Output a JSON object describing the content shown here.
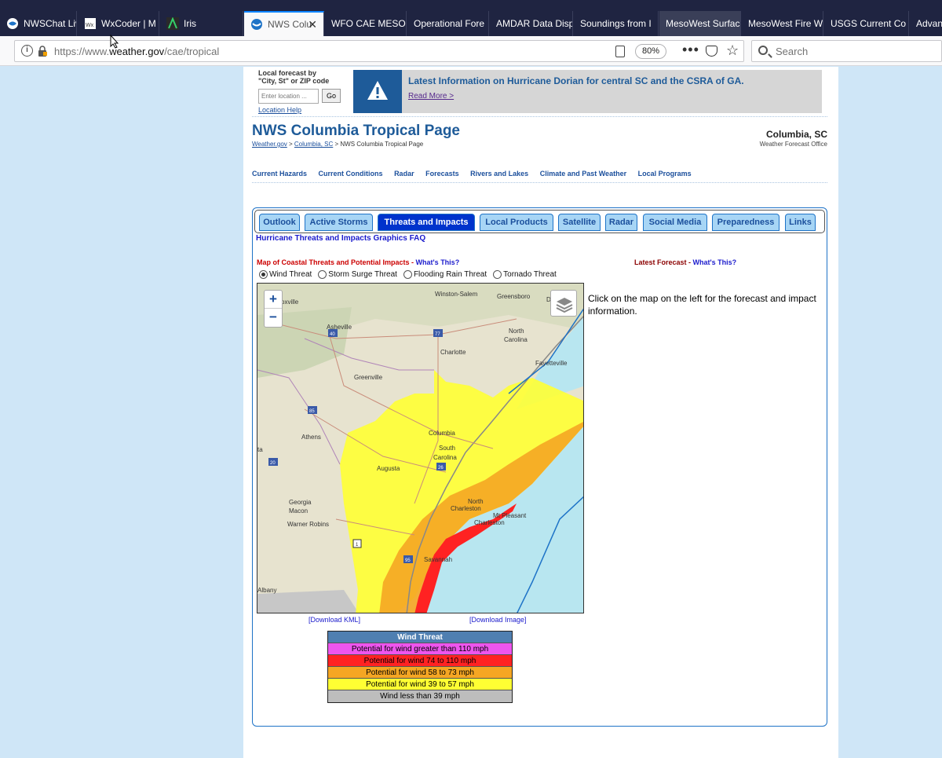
{
  "browser": {
    "tabs": [
      {
        "label": "NWSChat Liv"
      },
      {
        "label": "WxCoder | M"
      },
      {
        "label": "Iris"
      },
      {
        "label": "NWS Colu",
        "active": true
      },
      {
        "label": "WFO CAE MESOS"
      },
      {
        "label": "Operational Fore"
      },
      {
        "label": "AMDAR Data Disp"
      },
      {
        "label": "Soundings from I"
      },
      {
        "label": "MesoWest Surfac"
      },
      {
        "label": "MesoWest Fire W"
      },
      {
        "label": "USGS Current Co"
      },
      {
        "label": "Advan"
      }
    ],
    "url_prefix": "https://www.",
    "url_domain": "weather.gov",
    "url_path": "/cae/tropical",
    "zoom": "80%",
    "search_placeholder": "Search"
  },
  "location_box": {
    "label_line1": "Local forecast by",
    "label_line2": "\"City, St\" or ZIP code",
    "input_placeholder": "Enter location ...",
    "go_label": "Go",
    "help_link": "Location Help"
  },
  "alert": {
    "title": "Latest Information on Hurricane Dorian for central SC and the CSRA of GA.",
    "link": "Read More >"
  },
  "header": {
    "title": "NWS Columbia Tropical Page",
    "crumb1": "Weather.gov",
    "sep1": " > ",
    "crumb2": "Columbia, SC",
    "sep2": " > ",
    "crumb3": "NWS Columbia Tropical Page",
    "office": "Columbia, SC",
    "office_sub": "Weather Forecast Office"
  },
  "main_nav": [
    "Current Hazards",
    "Current Conditions",
    "Radar",
    "Forecasts",
    "Rivers and Lakes",
    "Climate and Past Weather",
    "Local Programs"
  ],
  "page_tabs": [
    "Outlook",
    "Active Storms",
    "Threats and Impacts",
    "Local Products",
    "Satellite",
    "Radar",
    "Social Media",
    "Preparedness",
    "Links"
  ],
  "selected_tab": "Threats and Impacts",
  "content": {
    "faq_link": "Hurricane Threats and Impacts Graphics FAQ",
    "map_title": "Map of Coastal Threats and Potential Impacts - ",
    "map_whats_this": "What's This?",
    "forecast_title": "Latest Forecast - ",
    "forecast_whats_this": "What's This?",
    "radios": [
      {
        "label": "Wind Threat",
        "checked": true
      },
      {
        "label": "Storm Surge Threat",
        "checked": false
      },
      {
        "label": "Flooding Rain Threat",
        "checked": false
      },
      {
        "label": "Tornado Threat",
        "checked": false
      }
    ],
    "map_hint": "Click on the map on the left for the forecast and impact information.",
    "download_kml": "[Download KML]",
    "download_image": "[Download Image]"
  },
  "map_labels": {
    "knoxville": "oxville",
    "winston": "Winston-Salem",
    "greensboro": "Greensboro",
    "d": "D",
    "asheville": "Asheville",
    "north": "North",
    "carolina": "Carolina",
    "charlotte": "Charlotte",
    "fayetteville": "Fayetteville",
    "greenville": "Greenville",
    "athens": "Athens",
    "columbia": "Columbia",
    "south": "South",
    "sc_carolina": "Carolina",
    "ta": "ta",
    "augusta": "Augusta",
    "georgia": "Georgia",
    "macon": "Macon",
    "north2": "North",
    "charleston1": "Charleston",
    "charleston2": "Charleston",
    "mtpleasant": "Mt Pleasant",
    "warner": "Warner Robins",
    "savannah": "Savannah",
    "albany": "Albany",
    "i40": "40",
    "i77": "77",
    "i85": "85",
    "i20": "20",
    "i26": "26",
    "i95": "95",
    "i1": "1"
  },
  "legend": {
    "title": "Wind Threat",
    "rows": [
      {
        "label": "Potential for wind greater than 110 mph",
        "color": "#ee55ee"
      },
      {
        "label": "Potential for wind 74 to 110 mph",
        "color": "#ff2222"
      },
      {
        "label": "Potential for wind 58 to 73 mph",
        "color": "#f5a623"
      },
      {
        "label": "Potential for wind 39 to 57 mph",
        "color": "#ffff33"
      },
      {
        "label": "Wind less than 39 mph",
        "color": "#bdbdbd"
      }
    ]
  }
}
